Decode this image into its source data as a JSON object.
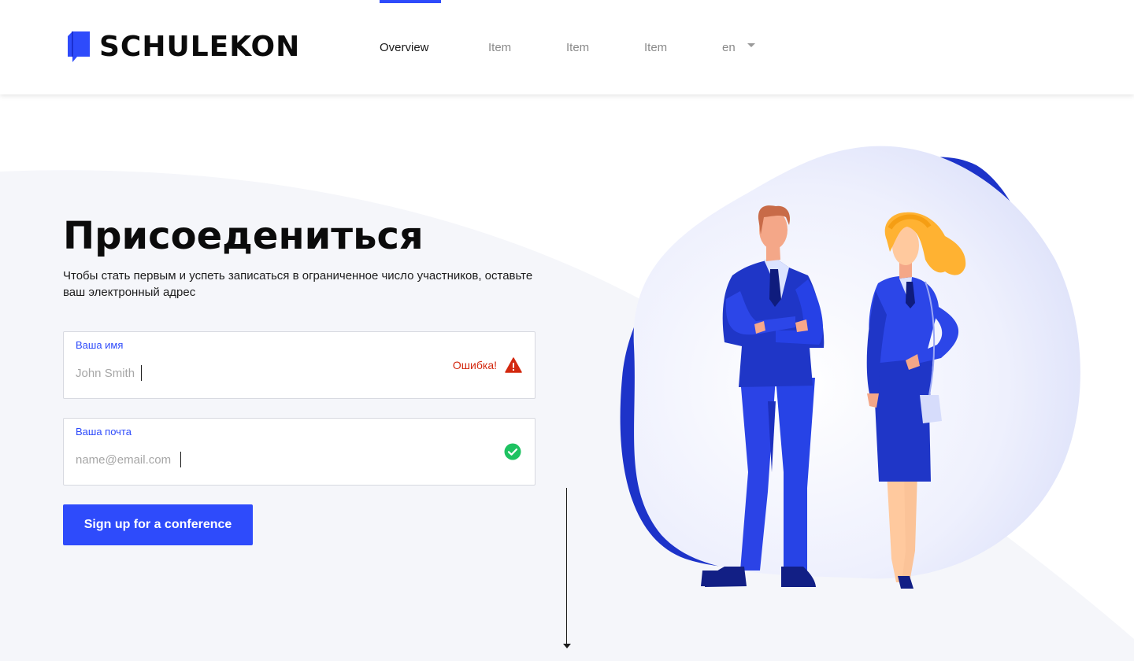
{
  "colors": {
    "accent": "#2e4bfb",
    "error": "#d3280f",
    "success": "#1ec261",
    "background_panel": "#f5f6fa"
  },
  "header": {
    "logo_text": "SCHULEKON",
    "nav": [
      {
        "label": "Overview",
        "active": true
      },
      {
        "label": "Item"
      },
      {
        "label": "Item"
      },
      {
        "label": "Item"
      }
    ],
    "language": "en"
  },
  "main": {
    "title": "Присоедениться",
    "subtitle": "Чтобы стать первым и успеть записаться в ограниченное число участников, оставьте ваш электронный адрес",
    "name_field": {
      "label": "Ваша имя",
      "placeholder": "John Smith",
      "error": "Ошибка!",
      "status_icon": "warning-icon"
    },
    "email_field": {
      "label": "Ваша почта",
      "placeholder": "name@email.com",
      "status_icon": "check-circle-icon"
    },
    "submit_label": "Sign up for a conference"
  }
}
